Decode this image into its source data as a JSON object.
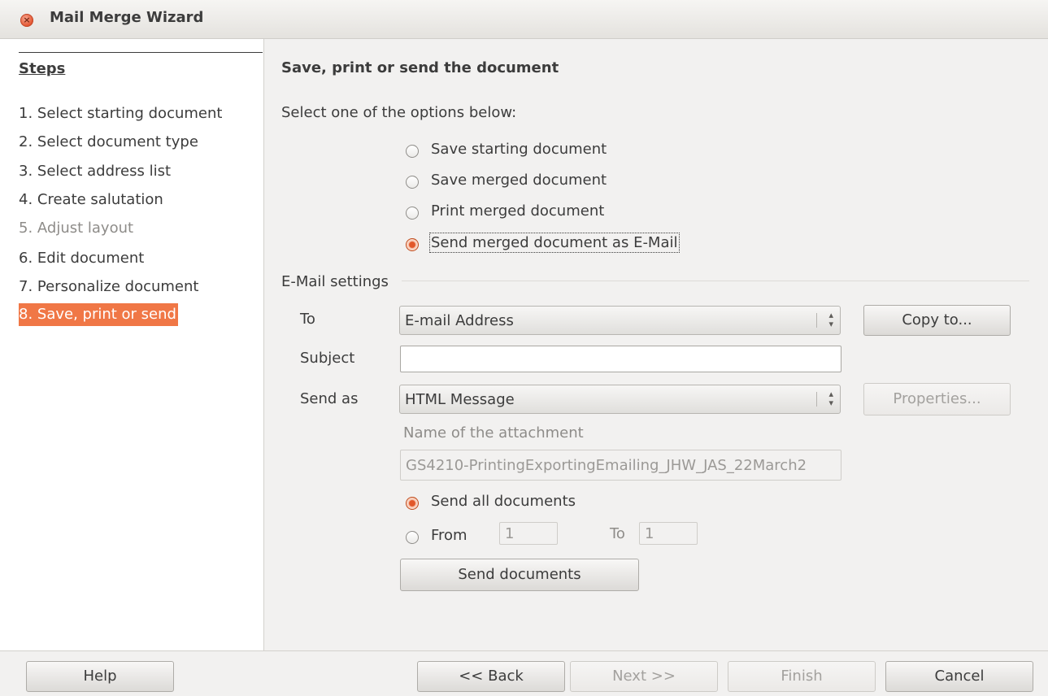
{
  "window": {
    "title": "Mail Merge Wizard",
    "close_icon": "×"
  },
  "sidebar": {
    "header": "Steps",
    "steps": [
      {
        "label": "1. Select starting document",
        "state": "normal"
      },
      {
        "label": "2. Select document type",
        "state": "normal"
      },
      {
        "label": "3. Select address list",
        "state": "normal"
      },
      {
        "label": "4. Create salutation",
        "state": "normal"
      },
      {
        "label": "5. Adjust layout",
        "state": "disabled"
      },
      {
        "label": "6. Edit document",
        "state": "normal"
      },
      {
        "label": "7. Personalize document",
        "state": "normal"
      },
      {
        "label": "8. Save, print or send",
        "state": "active"
      }
    ]
  },
  "main": {
    "title": "Save, print or send the document",
    "prompt": "Select one of the options below:",
    "options": [
      {
        "label": "Save starting document",
        "checked": false
      },
      {
        "label": "Save merged document",
        "checked": false
      },
      {
        "label": "Print merged document",
        "checked": false
      },
      {
        "label": "Send merged document as E-Mail",
        "checked": true
      }
    ]
  },
  "email": {
    "group_label": "E-Mail settings",
    "to_label": "To",
    "to_value": "E-mail Address",
    "copy_to_button": "Copy to...",
    "subject_label": "Subject",
    "subject_value": "",
    "send_as_label": "Send as",
    "send_as_value": "HTML Message",
    "properties_button": "Properties...",
    "attachment_label": "Name of the attachment",
    "attachment_value": "GS4210-PrintingExportingEmailing_JHW_JAS_22March2",
    "send_all_label": "Send all documents",
    "send_all_checked": true,
    "from_label": "From",
    "from_value": "1",
    "to_range_label": "To",
    "to_range_value": "1",
    "send_documents_button": "Send documents"
  },
  "footer": {
    "help": "Help",
    "back": "<< Back",
    "next": "Next >>",
    "finish": "Finish",
    "cancel": "Cancel"
  },
  "colors": {
    "accent": "#f07746",
    "radio_checked": "#e2582a"
  }
}
